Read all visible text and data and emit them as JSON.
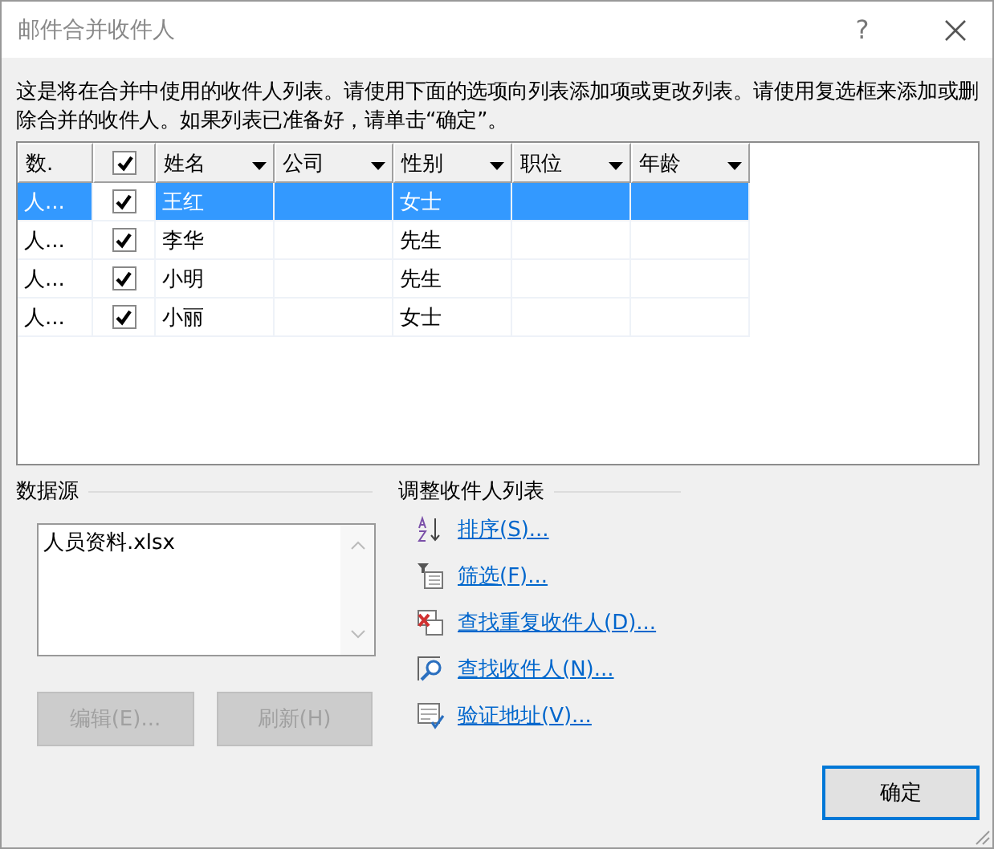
{
  "window": {
    "title": "邮件合并收件人",
    "help": "?"
  },
  "description": "这是将在合并中使用的收件人列表。请使用下面的选项向列表添加项或更改列表。请使用复选框来添加或删除合并的收件人。如果列表已准备好，请单击“确定”。",
  "table": {
    "header_checked": true,
    "columns": [
      {
        "label": "数.",
        "dropdown": false
      },
      {
        "label": "姓名",
        "dropdown": true
      },
      {
        "label": "公司",
        "dropdown": true
      },
      {
        "label": "性别",
        "dropdown": true
      },
      {
        "label": "职位",
        "dropdown": true
      },
      {
        "label": "年龄",
        "dropdown": true
      }
    ],
    "rows": [
      {
        "source": "人...",
        "checked": true,
        "name": "王红",
        "company": "",
        "gender": "女士",
        "selected": true
      },
      {
        "source": "人...",
        "checked": true,
        "name": "李华",
        "company": "",
        "gender": "先生",
        "selected": false
      },
      {
        "source": "人...",
        "checked": true,
        "name": "小明",
        "company": "",
        "gender": "先生",
        "selected": false
      },
      {
        "source": "人...",
        "checked": true,
        "name": "小丽",
        "company": "",
        "gender": "女士",
        "selected": false
      }
    ]
  },
  "data_source": {
    "heading": "数据源",
    "items": [
      "人员资料.xlsx"
    ],
    "buttons": [
      {
        "label": "编辑(E)...",
        "disabled": true
      },
      {
        "label": "刷新(H)",
        "disabled": true
      }
    ]
  },
  "refine": {
    "heading": "调整收件人列表",
    "links": [
      {
        "kind": "sort",
        "label": "排序(S)..."
      },
      {
        "kind": "filter",
        "label": "筛选(F)..."
      },
      {
        "kind": "duplicates",
        "label": "查找重复收件人(D)..."
      },
      {
        "kind": "find",
        "label": "查找收件人(N)..."
      },
      {
        "kind": "validate",
        "label": "验证地址(V)..."
      }
    ]
  },
  "ok_button": "确定"
}
